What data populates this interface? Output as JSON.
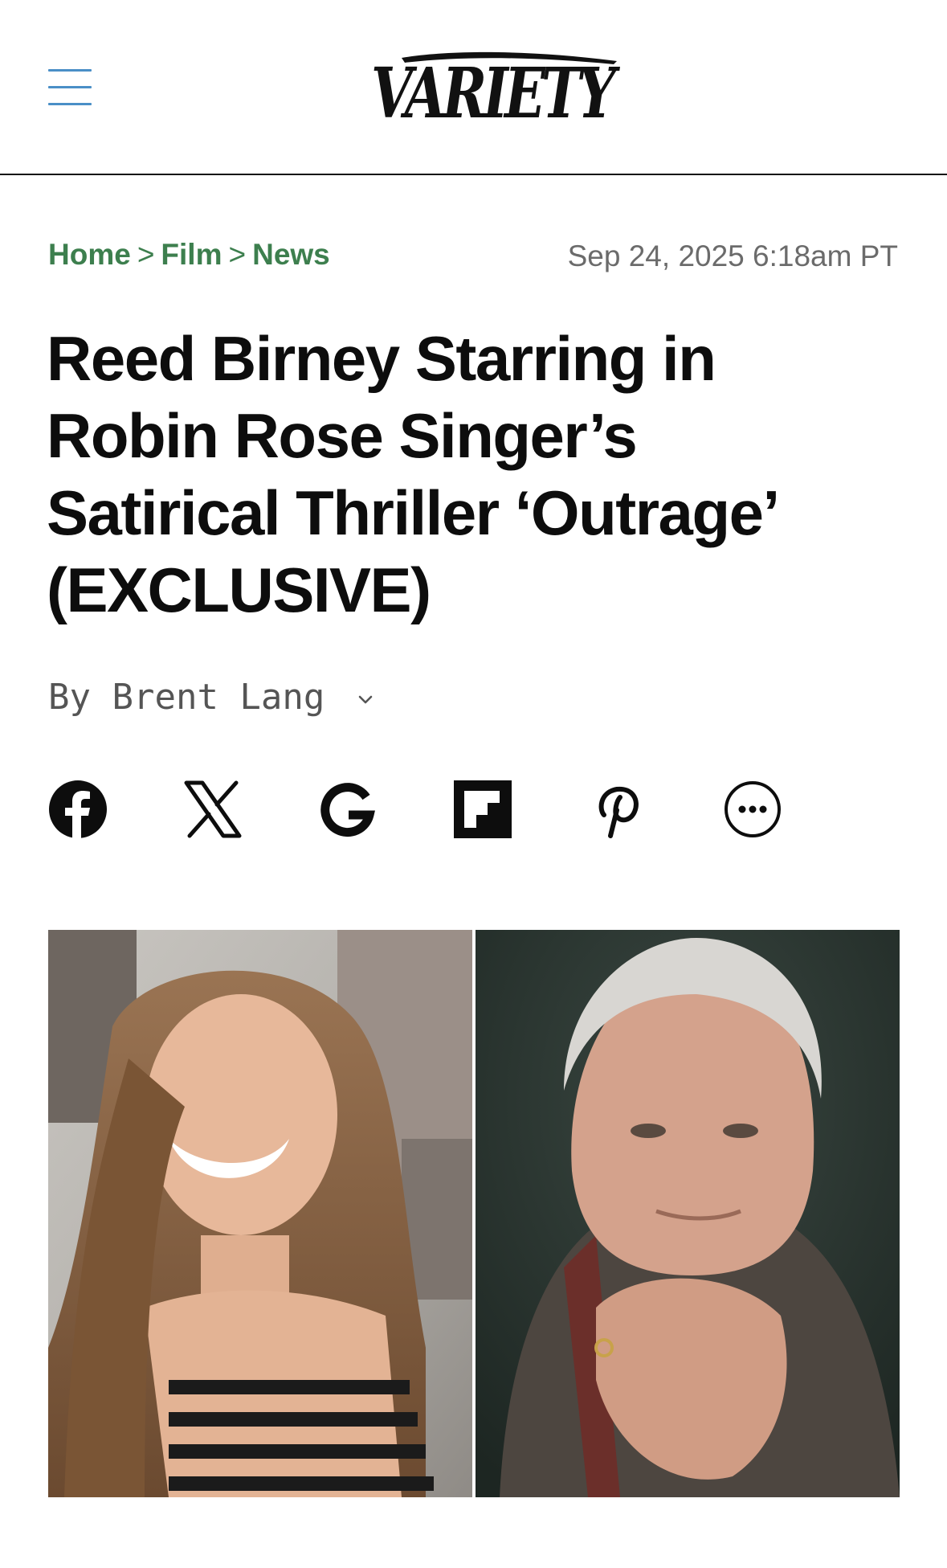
{
  "header": {
    "menu_icon": "hamburger-menu-icon",
    "logo_text": "VARIETY"
  },
  "breadcrumb": {
    "items": [
      "Home",
      "Film",
      "News"
    ],
    "separator": ">"
  },
  "article": {
    "date": "Sep 24, 2025 6:18am PT",
    "headline_lines": [
      "Reed Birney Starring in",
      "Robin Rose Singer’s",
      "Satirical Thriller ‘Outrage’",
      "(EXCLUSIVE)"
    ],
    "byline_prefix": "By",
    "author": "Brent Lang"
  },
  "share": {
    "icons": [
      "facebook-icon",
      "x-icon",
      "google-icon",
      "flipboard-icon",
      "pinterest-icon",
      "more-icon"
    ]
  },
  "colors": {
    "breadcrumb": "#3d7f4e",
    "menu": "#4a8fc7",
    "text": "#0d0d0d",
    "meta": "#6b6b6b"
  }
}
